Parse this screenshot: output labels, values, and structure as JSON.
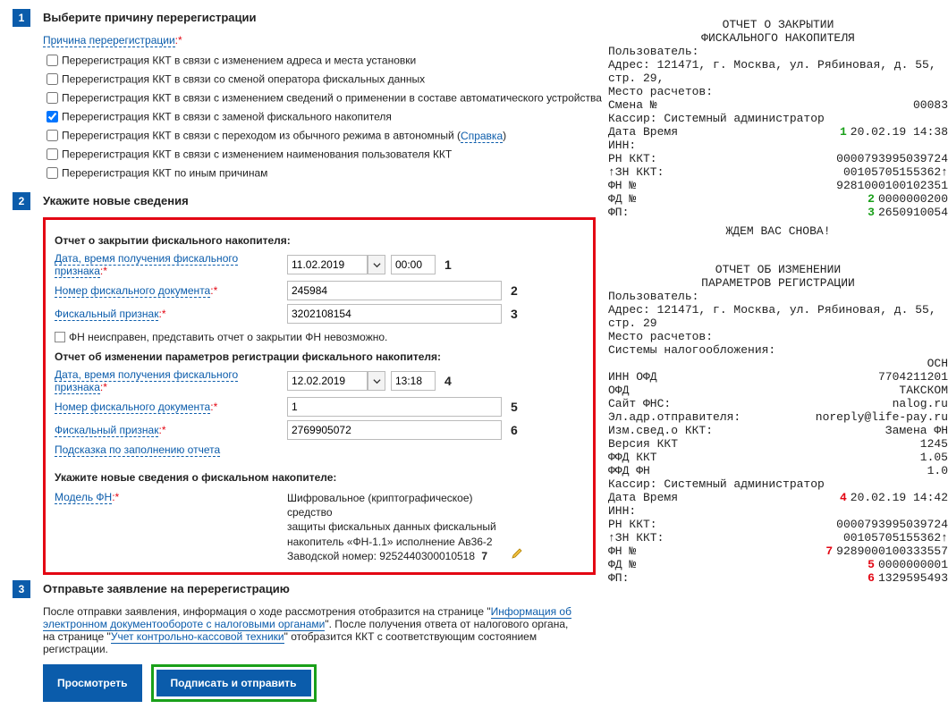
{
  "step1": {
    "num": "1",
    "title": "Выберите причину перерегистрации",
    "cause_link": "Причина перерегистрации",
    "reasons": [
      {
        "label": "Перерегистрация ККТ в связи с изменением адреса и места установки",
        "checked": false
      },
      {
        "label": "Перерегистрация ККТ в связи со сменой оператора фискальных данных",
        "checked": false
      },
      {
        "label": "Перерегистрация ККТ в связи с изменением сведений о применении в составе автоматического устройства",
        "checked": false
      },
      {
        "label": "Перерегистрация ККТ в связи с заменой фискального накопителя",
        "checked": true
      },
      {
        "label_before": "Перерегистрация ККТ в связи с переходом из обычного режима в автономный (",
        "help": "Справка",
        "label_after": ")",
        "checked": false
      },
      {
        "label": "Перерегистрация ККТ в связи с изменением наименования пользователя ККТ",
        "checked": false
      },
      {
        "label": "Перерегистрация ККТ по иным причинам",
        "checked": false
      }
    ]
  },
  "step2": {
    "num": "2",
    "title": "Укажите новые сведения",
    "close_report": {
      "heading": "Отчет о закрытии фискального накопителя:",
      "date_label": "Дата, время получения фискального признака",
      "date": "11.02.2019",
      "time": "00:00",
      "num_mark": "1",
      "doc_label": "Номер фискального документа",
      "doc": "245984",
      "doc_mark": "2",
      "sign_label": "Фискальный признак",
      "sign": "3202108154",
      "sign_mark": "3",
      "fn_broken": "ФН неисправен, представить отчет о закрытии ФН невозможно."
    },
    "change_report": {
      "heading": "Отчет об изменении параметров регистрации фискального накопителя:",
      "date_label": "Дата, время получения фискального признака",
      "date": "12.02.2019",
      "time": "13:18",
      "num_mark": "4",
      "doc_label": "Номер фискального документа",
      "doc": "1",
      "doc_mark": "5",
      "sign_label": "Фискальный признак",
      "sign": "2769905072",
      "sign_mark": "6",
      "hint": "Подсказка по заполнению отчета"
    },
    "new_fn": {
      "heading": "Укажите новые сведения о фискальном накопителе:",
      "model_label": "Модель ФН",
      "model_text_l1": "Шифровальное (криптографическое) средство",
      "model_text_l2": "защиты фискальных данных фискальный",
      "model_text_l3": "накопитель «ФН-1.1» исполнение Ав36-2",
      "serial_label": "Заводской номер: ",
      "serial": "9252440300010518",
      "serial_mark": "7"
    }
  },
  "step3": {
    "num": "3",
    "title": "Отправьте заявление на перерегистрацию",
    "text_before1": "После отправки заявления, информация о ходе рассмотрения отобразится на странице \"",
    "link1": "Информация об электронном документообороте с налоговыми органами",
    "text_mid": "\". После получения ответа от налогового органа, на странице \"",
    "link2": "Учет контрольно-кассовой техники",
    "text_after": "\" отобразится ККТ с соответствующим состоянием регистрации.",
    "btn_view": "Просмотреть",
    "btn_sign": "Подписать и отправить"
  },
  "receipt1": {
    "title1": "ОТЧЕТ О ЗАКРЫТИИ",
    "title2": "ФИСКАЛЬНОГО НАКОПИТЕЛЯ",
    "user_lbl": "Пользователь:",
    "addr1": "Адрес: 121471, г. Москва, ул. Рябиновая, д. 55,",
    "addr2": "стр. 29,",
    "place_lbl": "Место расчетов:",
    "shift_lbl": "Смена №",
    "shift_val": "00083",
    "cashier": "Кассир: Системный администратор",
    "dt_lbl": "Дата Время",
    "dt_val": "20.02.19 14:38",
    "inn_lbl": "ИНН:",
    "rn_lbl": "РН ККТ:",
    "rn_val": "0000793995039724",
    "zn_lbl": "↑ЗН ККТ:",
    "zn_val": "00105705155362↑",
    "fnnum_lbl": "ФН №",
    "fnnum_val": "9281000100102351",
    "fd_lbl": "ФД №",
    "fd_val": "0000000200",
    "fp_lbl": "ФП:",
    "fp_val": "2650910054",
    "thanks": "ЖДЕМ ВАС СНОВА!"
  },
  "receipt2": {
    "title1": "ОТЧЕТ ОБ ИЗМЕНЕНИИ",
    "title2": "ПАРАМЕТРОВ РЕГИСТРАЦИИ",
    "user_lbl": "Пользователь:",
    "addr1": "Адрес: 121471, г. Москва, ул. Рябиновая, д. 55,",
    "addr2": "стр. 29",
    "place_lbl": "Место расчетов:",
    "tax_lbl": "Системы налогообложения:",
    "tax_val": "ОСН",
    "innofd_lbl": "ИНН ОФД",
    "innofd_val": "7704211201",
    "ofd_lbl": "ОФД",
    "ofd_val": "ТАКСКОМ",
    "fns_lbl": "Сайт ФНС:",
    "fns_val": "nalog.ru",
    "email_lbl": "Эл.адр.отправителя:",
    "email_val": "noreply@life-pay.ru",
    "izm_lbl": "Изм.свед.о ККТ:",
    "izm_val": "Замена ФН",
    "ver_lbl": "Версия ККТ",
    "ver_val": "1245",
    "ffdkkt_lbl": "ФФД ККТ",
    "ffdkkt_val": "1.05",
    "ffdfn_lbl": "ФФД ФН",
    "ffdfn_val": "1.0",
    "cashier": "Кассир: Системный администратор",
    "dt_lbl": "Дата Время",
    "dt_val": "20.02.19 14:42",
    "inn_lbl": "ИНН:",
    "rn_lbl": "РН ККТ:",
    "rn_val": "0000793995039724",
    "zn_lbl": "↑ЗН ККТ:",
    "zn_val": "00105705155362↑",
    "fnnum_lbl": "ФН №",
    "fnnum_val": "9289000100333557",
    "fd_lbl": "ФД №",
    "fd_val": "0000000001",
    "fp_lbl": "ФП:",
    "fp_val": "1329595493"
  }
}
